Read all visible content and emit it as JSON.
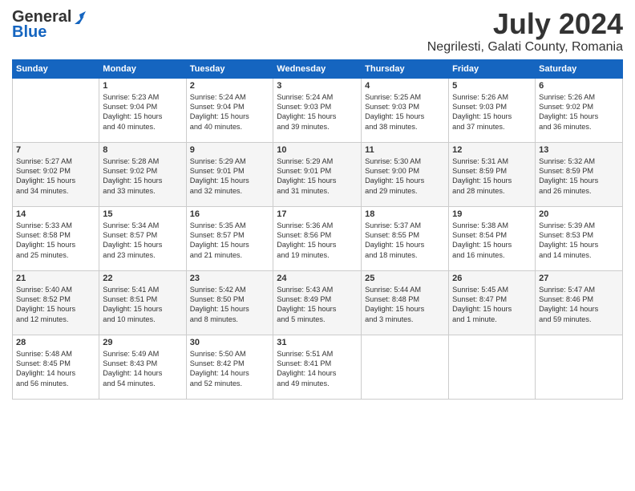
{
  "logo": {
    "general": "General",
    "blue": "Blue"
  },
  "title": "July 2024",
  "location": "Negrilesti, Galati County, Romania",
  "headers": [
    "Sunday",
    "Monday",
    "Tuesday",
    "Wednesday",
    "Thursday",
    "Friday",
    "Saturday"
  ],
  "weeks": [
    [
      {
        "day": "",
        "info": ""
      },
      {
        "day": "1",
        "info": "Sunrise: 5:23 AM\nSunset: 9:04 PM\nDaylight: 15 hours\nand 40 minutes."
      },
      {
        "day": "2",
        "info": "Sunrise: 5:24 AM\nSunset: 9:04 PM\nDaylight: 15 hours\nand 40 minutes."
      },
      {
        "day": "3",
        "info": "Sunrise: 5:24 AM\nSunset: 9:03 PM\nDaylight: 15 hours\nand 39 minutes."
      },
      {
        "day": "4",
        "info": "Sunrise: 5:25 AM\nSunset: 9:03 PM\nDaylight: 15 hours\nand 38 minutes."
      },
      {
        "day": "5",
        "info": "Sunrise: 5:26 AM\nSunset: 9:03 PM\nDaylight: 15 hours\nand 37 minutes."
      },
      {
        "day": "6",
        "info": "Sunrise: 5:26 AM\nSunset: 9:02 PM\nDaylight: 15 hours\nand 36 minutes."
      }
    ],
    [
      {
        "day": "7",
        "info": "Sunrise: 5:27 AM\nSunset: 9:02 PM\nDaylight: 15 hours\nand 34 minutes."
      },
      {
        "day": "8",
        "info": "Sunrise: 5:28 AM\nSunset: 9:02 PM\nDaylight: 15 hours\nand 33 minutes."
      },
      {
        "day": "9",
        "info": "Sunrise: 5:29 AM\nSunset: 9:01 PM\nDaylight: 15 hours\nand 32 minutes."
      },
      {
        "day": "10",
        "info": "Sunrise: 5:29 AM\nSunset: 9:01 PM\nDaylight: 15 hours\nand 31 minutes."
      },
      {
        "day": "11",
        "info": "Sunrise: 5:30 AM\nSunset: 9:00 PM\nDaylight: 15 hours\nand 29 minutes."
      },
      {
        "day": "12",
        "info": "Sunrise: 5:31 AM\nSunset: 8:59 PM\nDaylight: 15 hours\nand 28 minutes."
      },
      {
        "day": "13",
        "info": "Sunrise: 5:32 AM\nSunset: 8:59 PM\nDaylight: 15 hours\nand 26 minutes."
      }
    ],
    [
      {
        "day": "14",
        "info": "Sunrise: 5:33 AM\nSunset: 8:58 PM\nDaylight: 15 hours\nand 25 minutes."
      },
      {
        "day": "15",
        "info": "Sunrise: 5:34 AM\nSunset: 8:57 PM\nDaylight: 15 hours\nand 23 minutes."
      },
      {
        "day": "16",
        "info": "Sunrise: 5:35 AM\nSunset: 8:57 PM\nDaylight: 15 hours\nand 21 minutes."
      },
      {
        "day": "17",
        "info": "Sunrise: 5:36 AM\nSunset: 8:56 PM\nDaylight: 15 hours\nand 19 minutes."
      },
      {
        "day": "18",
        "info": "Sunrise: 5:37 AM\nSunset: 8:55 PM\nDaylight: 15 hours\nand 18 minutes."
      },
      {
        "day": "19",
        "info": "Sunrise: 5:38 AM\nSunset: 8:54 PM\nDaylight: 15 hours\nand 16 minutes."
      },
      {
        "day": "20",
        "info": "Sunrise: 5:39 AM\nSunset: 8:53 PM\nDaylight: 15 hours\nand 14 minutes."
      }
    ],
    [
      {
        "day": "21",
        "info": "Sunrise: 5:40 AM\nSunset: 8:52 PM\nDaylight: 15 hours\nand 12 minutes."
      },
      {
        "day": "22",
        "info": "Sunrise: 5:41 AM\nSunset: 8:51 PM\nDaylight: 15 hours\nand 10 minutes."
      },
      {
        "day": "23",
        "info": "Sunrise: 5:42 AM\nSunset: 8:50 PM\nDaylight: 15 hours\nand 8 minutes."
      },
      {
        "day": "24",
        "info": "Sunrise: 5:43 AM\nSunset: 8:49 PM\nDaylight: 15 hours\nand 5 minutes."
      },
      {
        "day": "25",
        "info": "Sunrise: 5:44 AM\nSunset: 8:48 PM\nDaylight: 15 hours\nand 3 minutes."
      },
      {
        "day": "26",
        "info": "Sunrise: 5:45 AM\nSunset: 8:47 PM\nDaylight: 15 hours\nand 1 minute."
      },
      {
        "day": "27",
        "info": "Sunrise: 5:47 AM\nSunset: 8:46 PM\nDaylight: 14 hours\nand 59 minutes."
      }
    ],
    [
      {
        "day": "28",
        "info": "Sunrise: 5:48 AM\nSunset: 8:45 PM\nDaylight: 14 hours\nand 56 minutes."
      },
      {
        "day": "29",
        "info": "Sunrise: 5:49 AM\nSunset: 8:43 PM\nDaylight: 14 hours\nand 54 minutes."
      },
      {
        "day": "30",
        "info": "Sunrise: 5:50 AM\nSunset: 8:42 PM\nDaylight: 14 hours\nand 52 minutes."
      },
      {
        "day": "31",
        "info": "Sunrise: 5:51 AM\nSunset: 8:41 PM\nDaylight: 14 hours\nand 49 minutes."
      },
      {
        "day": "",
        "info": ""
      },
      {
        "day": "",
        "info": ""
      },
      {
        "day": "",
        "info": ""
      }
    ]
  ]
}
